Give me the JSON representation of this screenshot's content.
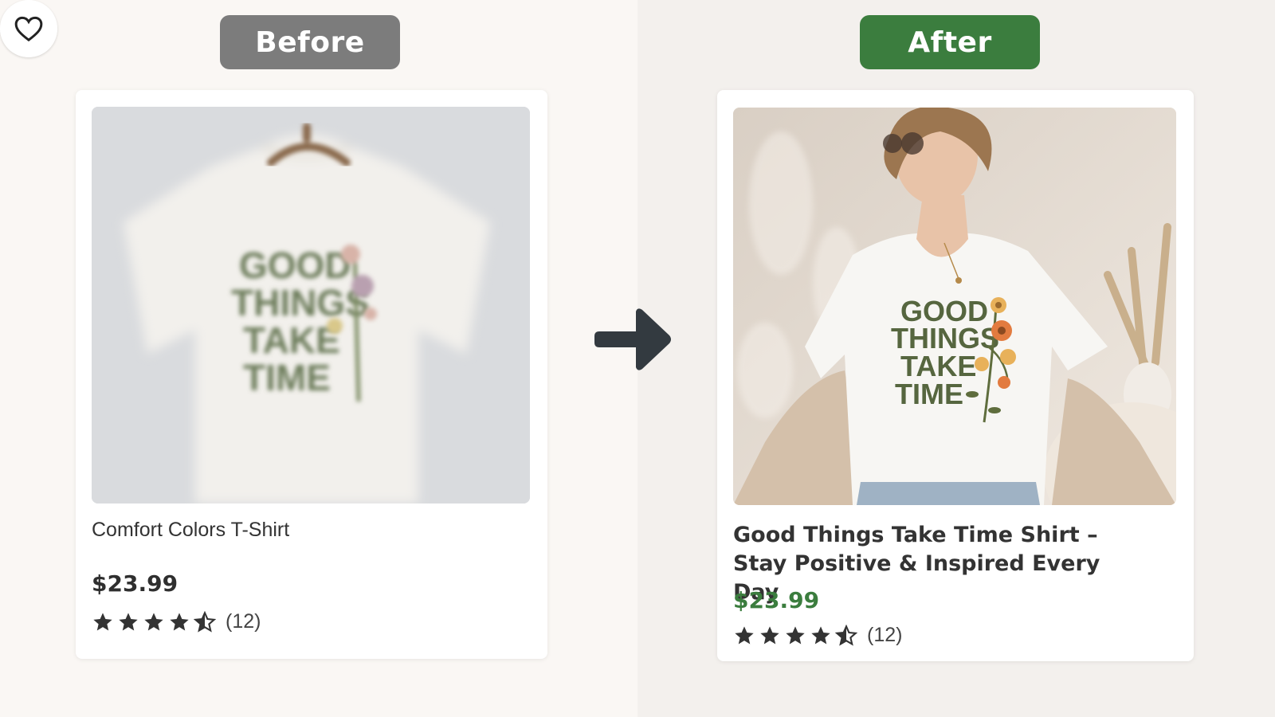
{
  "before": {
    "badge": "Before",
    "product": {
      "title": "Comfort Colors T-Shirt",
      "price": "$23.99",
      "rating": 4.5,
      "review_count": "(12)"
    }
  },
  "after": {
    "badge": "After",
    "product": {
      "title_line1": "Good Things Take Time Shirt –",
      "title_line2": "Stay Positive & Inspired Every Day",
      "price": "$23.99",
      "rating": 4.5,
      "review_count": "(12)"
    }
  },
  "shirt_print": [
    "GOOD",
    "THINGS",
    "TAKE",
    "TIME"
  ],
  "colors": {
    "before_badge": "#7c7c7c",
    "after_badge": "#3b7d3e",
    "after_price": "#3b7d3e",
    "arrow": "#333a40"
  },
  "icons": {
    "favorite": "heart-outline-icon",
    "star_full": "star-filled-icon",
    "star_half": "star-half-icon",
    "arrow": "arrow-right-icon"
  }
}
